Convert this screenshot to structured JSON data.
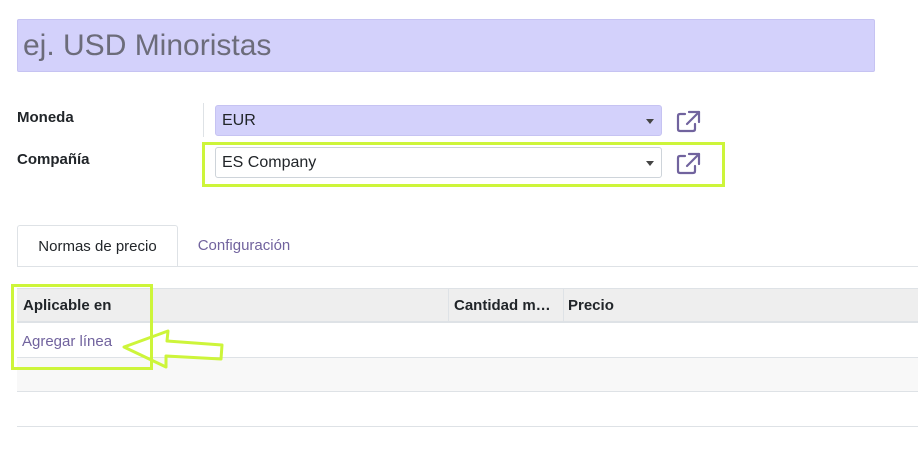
{
  "form": {
    "name_placeholder": "ej. USD Minoristas",
    "name_value": "",
    "currency_label": "Moneda",
    "currency_value": "EUR",
    "company_label": "Compañía",
    "company_value": "ES Company"
  },
  "tabs": [
    {
      "label": "Normas de precio",
      "active": true
    },
    {
      "label": "Configuración",
      "active": false
    }
  ],
  "table": {
    "columns": [
      "Aplicable en",
      "Cantidad m…",
      "Precio"
    ],
    "add_line": "Agregar línea",
    "rows": []
  },
  "icons": {
    "external_link": "external-link-icon",
    "dropdown": "caret-down-icon",
    "annotation_arrow": "left-arrow-annotation"
  },
  "colors": {
    "accent": "#71639e",
    "required_field_bg": "#d3d1fb",
    "highlight": "#cdf53a"
  }
}
